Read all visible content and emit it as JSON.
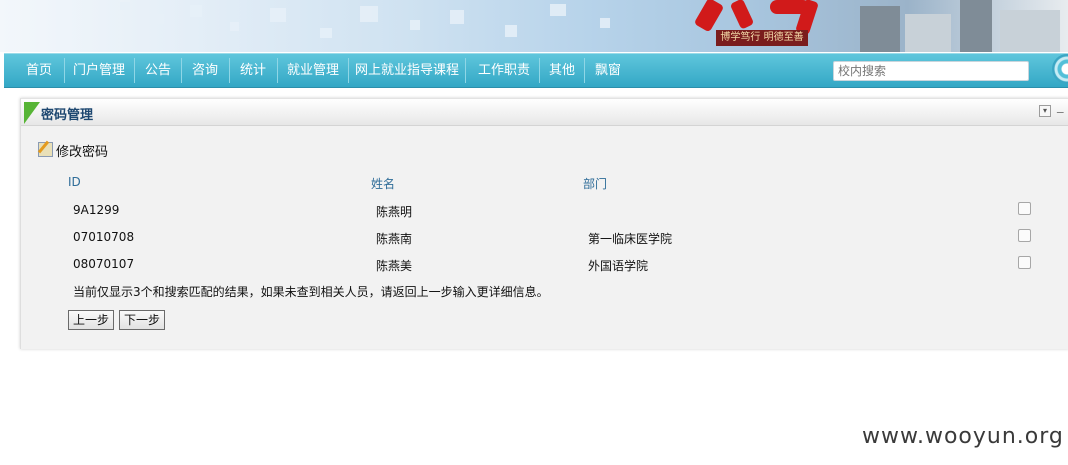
{
  "banner": {
    "slogan": "博学笃行 明德至善"
  },
  "nav": {
    "items": [
      {
        "label": "首页"
      },
      {
        "label": "门户管理"
      },
      {
        "label": "公告"
      },
      {
        "label": "咨询"
      },
      {
        "label": "统计"
      },
      {
        "label": "就业管理"
      },
      {
        "label": "网上就业指导课程"
      },
      {
        "label": "工作职责"
      },
      {
        "label": "其他"
      },
      {
        "label": "飘窗"
      }
    ]
  },
  "search": {
    "placeholder": "校内搜索"
  },
  "panel": {
    "title": "密码管理",
    "action_label": "修改密码",
    "table": {
      "headers": [
        "ID",
        "姓名",
        "部门"
      ],
      "rows": [
        {
          "id": "9A1299",
          "name": "陈燕明",
          "dept": ""
        },
        {
          "id": "07010708",
          "name": "陈燕南",
          "dept": "第一临床医学院"
        },
        {
          "id": "08070107",
          "name": "陈燕美",
          "dept": "外国语学院"
        }
      ]
    },
    "note": "当前仅显示3个和搜索匹配的结果，如果未查到相关人员，请返回上一步输入更详细信息。",
    "prev_label": "上一步",
    "next_label": "下一步"
  },
  "watermark": "www.wooyun.org",
  "colors": {
    "nav_bg": "#3fb2cd",
    "accent_green": "#57b536",
    "header_text": "#2e6c98"
  }
}
